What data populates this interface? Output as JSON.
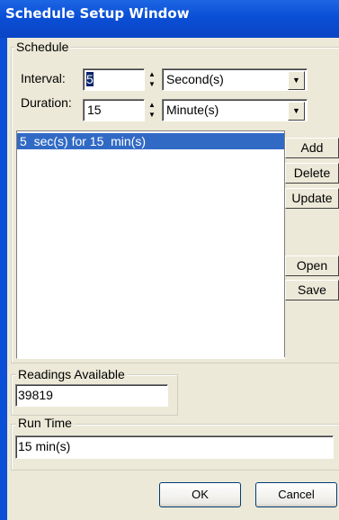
{
  "window": {
    "title": "Schedule Setup Window"
  },
  "schedule": {
    "group_label": "Schedule",
    "interval": {
      "label": "Interval:",
      "value": "5",
      "unit": "Second(s)"
    },
    "duration": {
      "label": "Duration:",
      "value": "15",
      "unit": "Minute(s)"
    },
    "entries": [
      "5  sec(s) for 15  min(s)"
    ],
    "buttons": {
      "add": "Add",
      "delete": "Delete",
      "update": "Update",
      "open": "Open",
      "save": "Save"
    }
  },
  "readings": {
    "group_label": "Readings Available",
    "value": "39819"
  },
  "runtime": {
    "group_label": "Run Time",
    "value": "15 min(s)"
  },
  "dialog": {
    "ok": "OK",
    "cancel": "Cancel"
  },
  "icons": {
    "spin_up": "triangle-up",
    "spin_down": "triangle-down",
    "dropdown": "triangle-down"
  }
}
